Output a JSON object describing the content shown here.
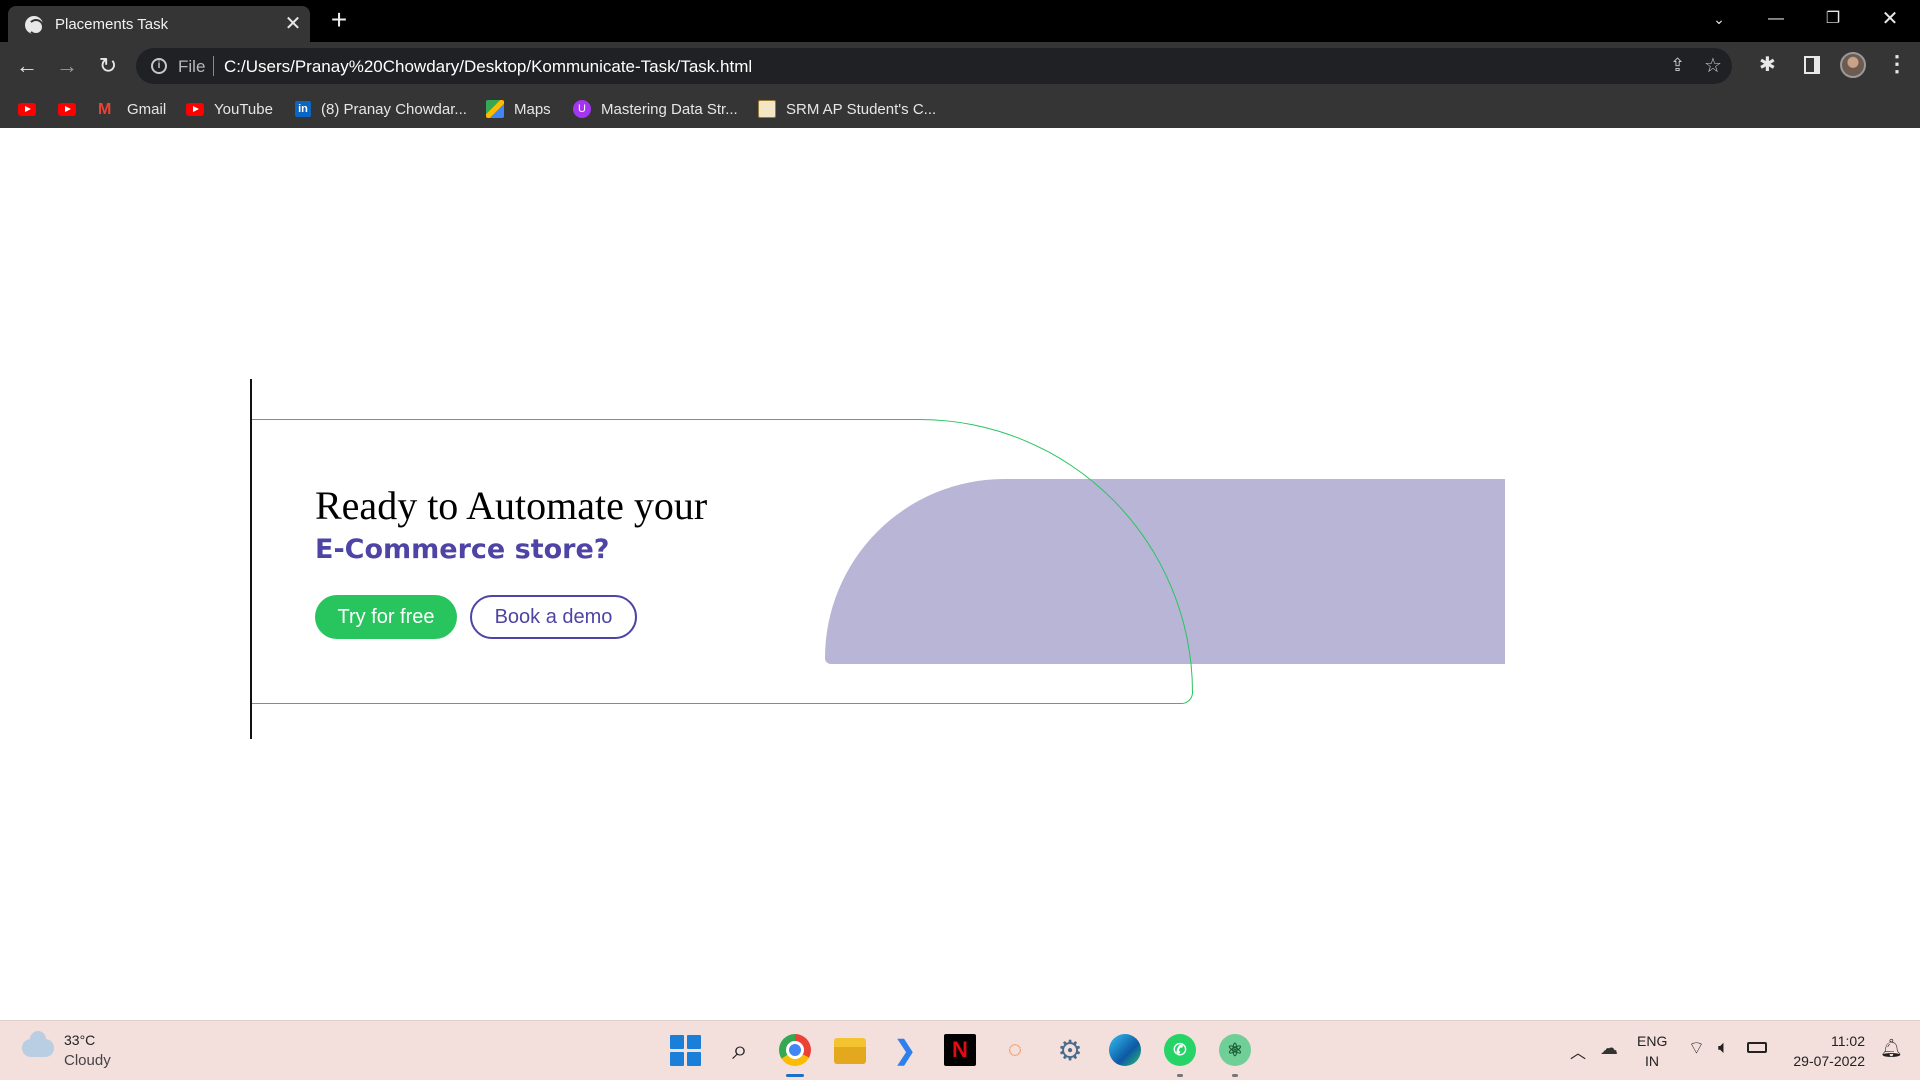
{
  "browser": {
    "tab_title": "Placements Task",
    "tab_close": "✕",
    "new_tab": "+",
    "url_scheme": "File",
    "url": "C:/Users/Pranay%20Chowdary/Desktop/Kommunicate-Task/Task.html"
  },
  "bookmarks": [
    {
      "label": "",
      "icon": "youtube-icon"
    },
    {
      "label": "",
      "icon": "youtube-icon"
    },
    {
      "label": "Gmail",
      "icon": "gmail-icon"
    },
    {
      "label": "YouTube",
      "icon": "youtube-icon"
    },
    {
      "label": "(8) Pranay Chowdar...",
      "icon": "linkedin-icon"
    },
    {
      "label": "Maps",
      "icon": "maps-icon"
    },
    {
      "label": "Mastering Data Str...",
      "icon": "udemy-icon"
    },
    {
      "label": "SRM AP Student's C...",
      "icon": "srm-icon"
    }
  ],
  "hero": {
    "headline": "Ready to Automate your",
    "subheadline": "E-Commerce store?",
    "primary_button": "Try for free",
    "secondary_button": "Book a demo"
  },
  "colors": {
    "brand_green": "#28c45e",
    "brand_purple": "#4d44a5",
    "shape_lavender": "#b8b5d6"
  },
  "taskbar": {
    "temperature": "33°C",
    "weather": "Cloudy",
    "lang_line1": "ENG",
    "lang_line2": "IN",
    "time": "11:02",
    "date": "29-07-2022",
    "apps": [
      "start",
      "search",
      "chrome",
      "file-explorer",
      "vscode",
      "netflix",
      "jupyter",
      "settings",
      "edge",
      "whatsapp",
      "atom"
    ]
  }
}
